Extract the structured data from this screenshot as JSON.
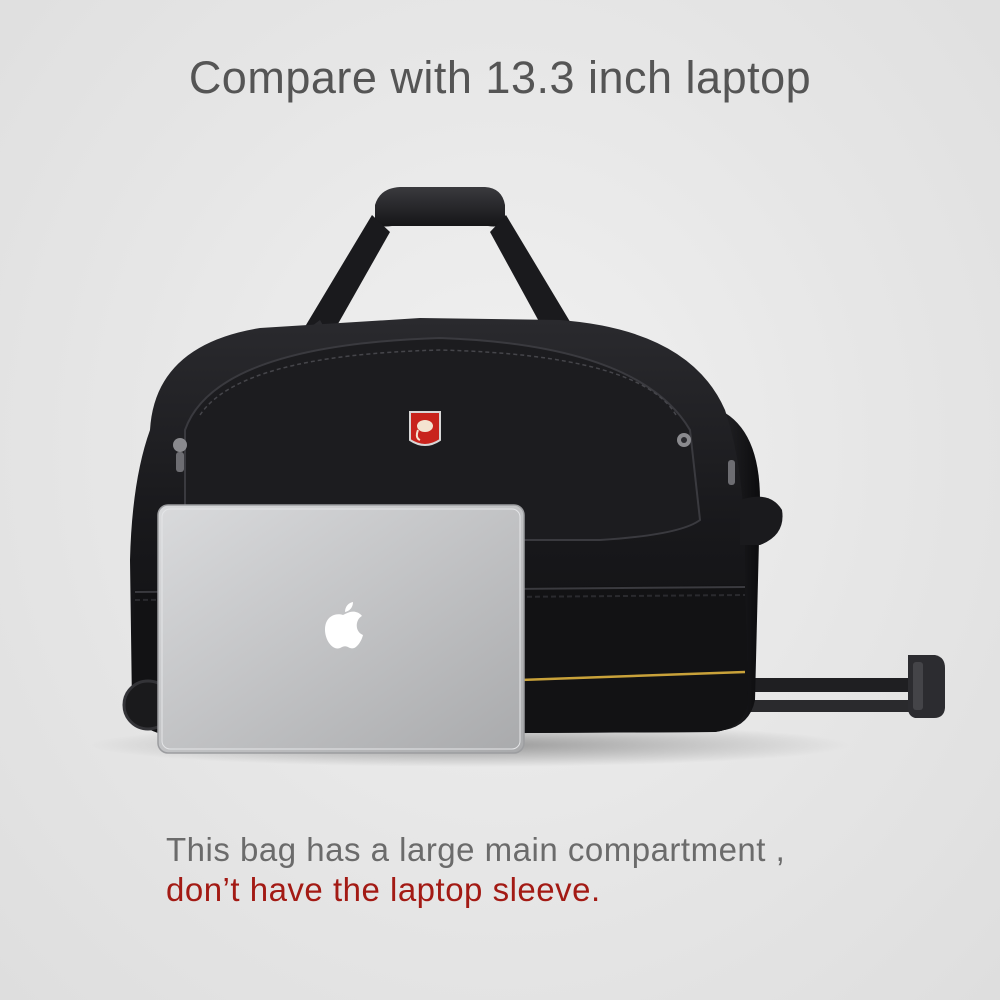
{
  "headline": "Compare with 13.3 inch laptop",
  "caption": {
    "line1": "This bag has a large main compartment ,",
    "line2": "don’t have the laptop sleeve."
  },
  "colors": {
    "background": "#e8e8e8",
    "headline": "#555555",
    "caption_gray": "#6b6b6b",
    "caption_red": "#a31a14",
    "bag": "#141416",
    "trim": "#c9a23a",
    "laptop": "#b9babc",
    "badge": "#c8231c"
  },
  "icons": [
    "apple-logo-icon",
    "elephant-badge-icon"
  ]
}
